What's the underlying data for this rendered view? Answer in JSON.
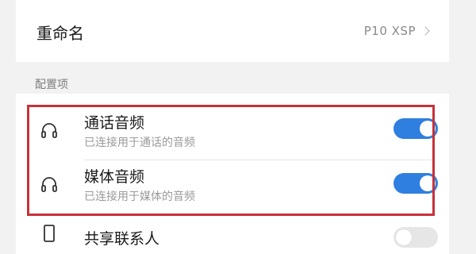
{
  "rename": {
    "label": "重命名",
    "value": "P10 XSP"
  },
  "section": {
    "title": "配置项"
  },
  "config_items": [
    {
      "title": "通话音频",
      "subtitle": "已连接用于通话的音频",
      "icon": "headphones-icon",
      "toggle": "on"
    },
    {
      "title": "媒体音频",
      "subtitle": "已连接用于媒体的音频",
      "icon": "headphones-icon",
      "toggle": "on"
    },
    {
      "title": "共享联系人",
      "icon": "phone-icon",
      "toggle": "off"
    }
  ],
  "colors": {
    "accent": "#2f7fe0",
    "highlight_border": "#c6323a",
    "background": "#f2f2f2"
  }
}
